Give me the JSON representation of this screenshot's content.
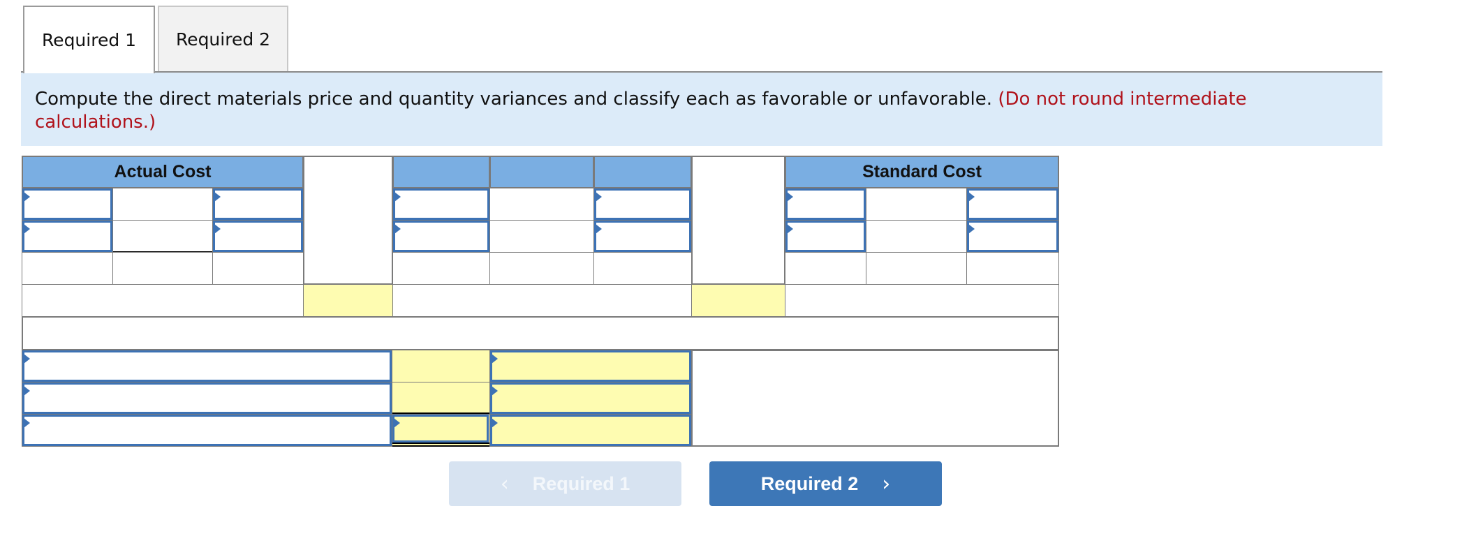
{
  "tabs": [
    {
      "label": "Required 1",
      "active": true
    },
    {
      "label": "Required 2",
      "active": false
    }
  ],
  "instruction": {
    "text": "Compute the direct materials price and quantity variances and classify each as favorable or unfavorable.",
    "note": "(Do not round intermediate calculations.)"
  },
  "table": {
    "headers": {
      "actual_cost": "Actual Cost",
      "standard_cost": "Standard Cost"
    },
    "cells_empty": true
  },
  "navigation": {
    "prev_label": "Required 1",
    "next_label": "Required 2",
    "prev_icon": "chevron-left-icon",
    "next_icon": "chevron-right-icon",
    "prev_disabled": true
  },
  "colors": {
    "header_blue": "#7aaee2",
    "input_border": "#3d72b4",
    "highlight_yellow": "#fefcb1",
    "instruction_bg": "#dcebf9",
    "note_red": "#b0121b",
    "next_button": "#3d77b7",
    "prev_button_disabled": "#d7e3f1"
  }
}
